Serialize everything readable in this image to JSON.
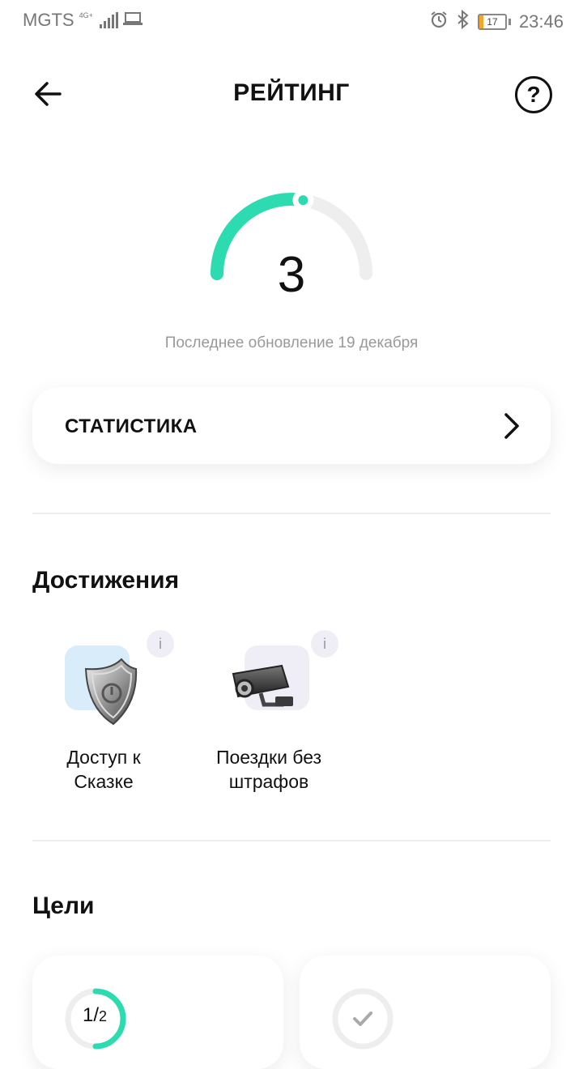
{
  "status_bar": {
    "carrier": "MGTS",
    "network": "4G+",
    "battery_level": "17",
    "time": "23:46"
  },
  "header": {
    "title": "РЕЙТИНГ",
    "help_label": "?"
  },
  "rating": {
    "value": "3",
    "gauge_fraction": 0.55,
    "last_update": "Последнее обновление 19 декабря"
  },
  "stats": {
    "label": "СТАТИСТИКА"
  },
  "achievements": {
    "title": "Достижения",
    "items": [
      {
        "label_line1": "Доступ к",
        "label_line2": "Сказке",
        "info": "i",
        "icon": "shield-icon"
      },
      {
        "label_line1": "Поездки без",
        "label_line2": "штрафов",
        "info": "i",
        "icon": "camera-icon"
      }
    ]
  },
  "goals": {
    "title": "Цели",
    "items": [
      {
        "progress_num": "1",
        "progress_den": "2",
        "progress_fraction": 0.5
      },
      {
        "icon": "check-icon",
        "progress_fraction": 0
      }
    ]
  },
  "colors": {
    "accent": "#2cdcb0",
    "track": "#eeeeee",
    "tile_blue": "#d9ecfa",
    "tile_lavender": "#efeef6"
  }
}
